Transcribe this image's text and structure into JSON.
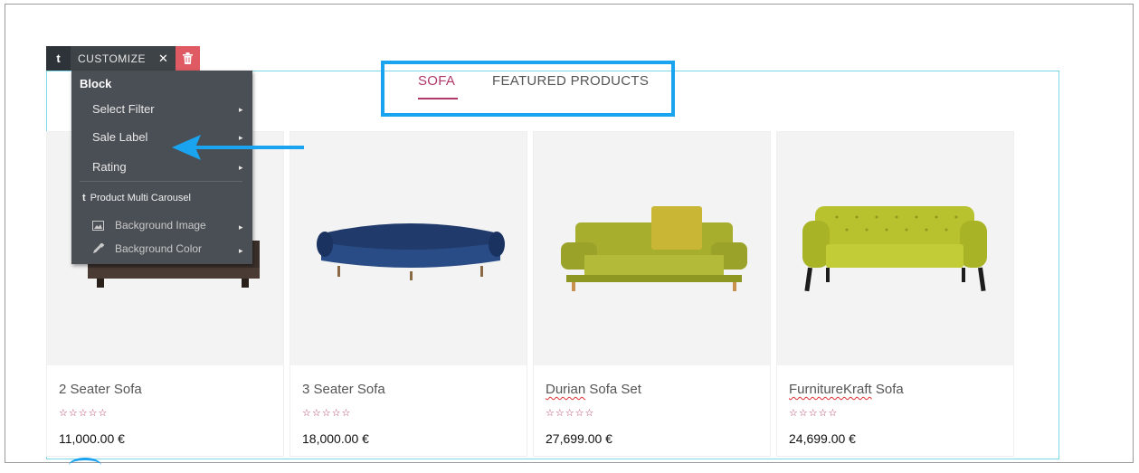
{
  "toolbar": {
    "logo_label": "t",
    "customize_label": "CUSTOMIZE",
    "close_label": "✕"
  },
  "menu": {
    "heading": "Block",
    "items": [
      {
        "label": "Select Filter",
        "caret": "▸"
      },
      {
        "label": "Sale Label",
        "caret": "▸"
      },
      {
        "label": "Rating",
        "caret": "▸"
      }
    ],
    "section_icon": "t",
    "section_title": "Product Multi Carousel",
    "sub_items": [
      {
        "label": "Background Image",
        "icon": "image-icon",
        "caret": "▸"
      },
      {
        "label": "Background Color",
        "icon": "eyedropper-icon",
        "caret": "▸"
      }
    ]
  },
  "tabs": [
    {
      "label": "SOFA",
      "active": true
    },
    {
      "label": "FEATURED PRODUCTS",
      "active": false
    }
  ],
  "products": [
    {
      "name": "2 Seater Sofa",
      "name_parts": [
        "",
        "2 Seater Sofa"
      ],
      "rating_stars": "☆☆☆☆☆",
      "price": "11,000.00 €"
    },
    {
      "name": "3 Seater Sofa",
      "name_parts": [
        "",
        "3 Seater Sofa"
      ],
      "rating_stars": "☆☆☆☆☆",
      "price": "18,000.00 €"
    },
    {
      "name": "Durian Sofa Set",
      "name_parts": [
        "Durian",
        " Sofa Set"
      ],
      "rating_stars": "☆☆☆☆☆",
      "price": "27,699.00 €"
    },
    {
      "name": "FurnitureKraft Sofa",
      "name_parts": [
        "FurnitureKraft",
        " Sofa"
      ],
      "rating_stars": "☆☆☆☆☆",
      "price": "24,699.00 €"
    }
  ],
  "colors": {
    "accent": "#b0396a",
    "highlight": "#1aa3ee",
    "toolbar_bg": "#3e4348",
    "delete_bg": "#e05a63",
    "menu_bg": "#4a4f55"
  }
}
